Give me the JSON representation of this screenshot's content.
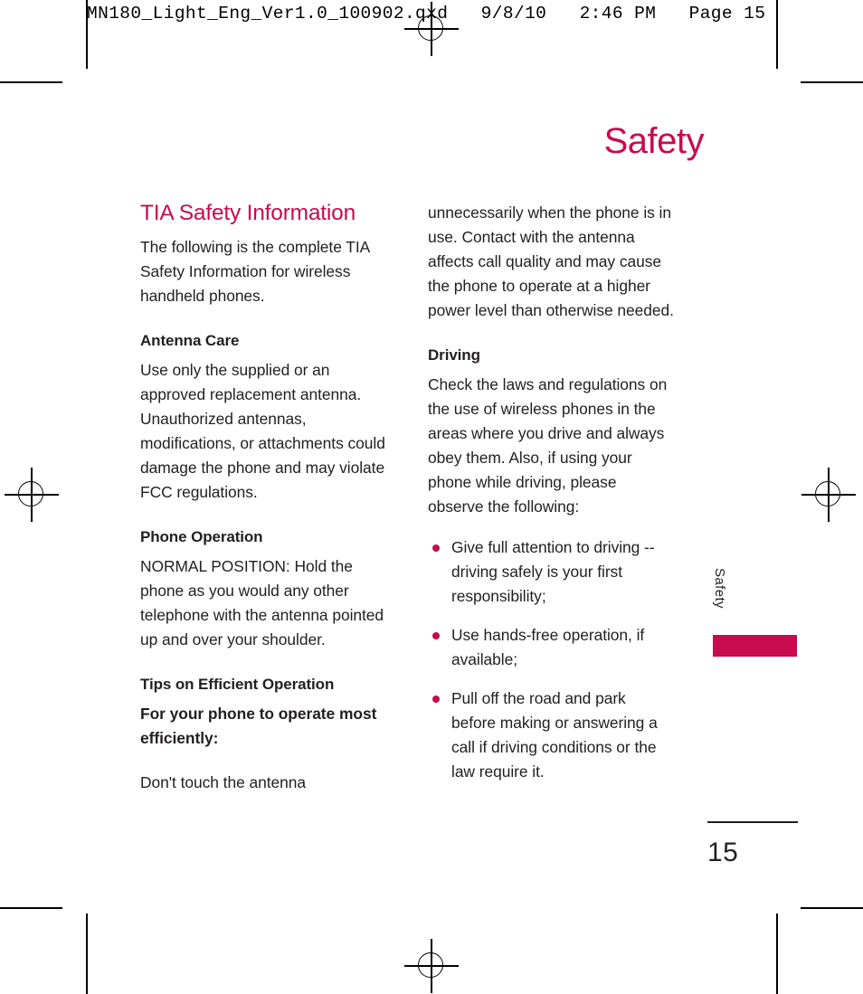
{
  "prepress": {
    "header_line": "MN180_Light_Eng_Ver1.0_100902.qxd   9/8/10   2:46 PM   Page 15"
  },
  "colors": {
    "accent": "#c80a4e",
    "text": "#231f20"
  },
  "page": {
    "title": "Safety",
    "folio_number": "15",
    "side_tab_label": "Safety"
  },
  "left_column": {
    "section_title": "TIA Safety Information",
    "intro": "The following is the complete TIA Safety Information for wireless handheld phones.",
    "blocks": [
      {
        "heading": "Antenna Care",
        "text": "Use only the supplied or an approved replacement antenna. Unauthorized antennas, modifications, or attachments could damage the phone and may violate FCC regulations."
      },
      {
        "heading": "Phone Operation",
        "text": "NORMAL POSITION: Hold the phone as you would any other telephone with the antenna pointed up and over your shoulder."
      },
      {
        "heading": "Tips on Efficient Operation",
        "text": "For your phone to operate most efficiently:",
        "text2": "Don't touch the antenna"
      }
    ]
  },
  "right_column": {
    "continuation": "unnecessarily when the phone is in use. Contact with the antenna affects call quality and may cause the phone to operate at a higher power level than otherwise needed.",
    "blocks": [
      {
        "heading": "Driving",
        "text": "Check the laws and regulations on the use of wireless phones in the areas where you drive and always obey them. Also, if using your phone while driving, please observe the following:"
      }
    ],
    "bullets": [
      "Give full attention to driving -- driving safely is your first responsibility;",
      "Use hands-free operation, if available;",
      "Pull off the road and park before making or answering a call if driving conditions or the law require it."
    ]
  }
}
